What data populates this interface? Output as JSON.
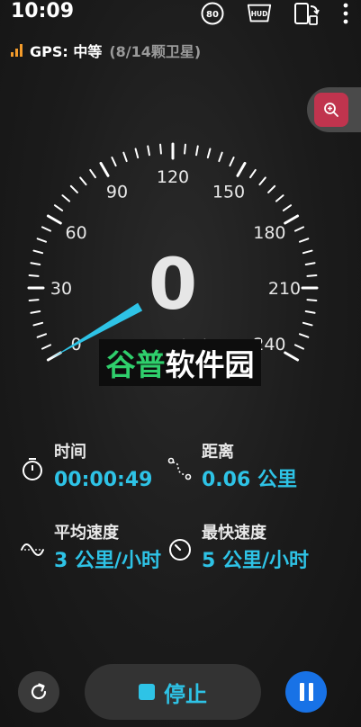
{
  "status_bar": {
    "time": "10:09",
    "speed_limit": "80",
    "hud_label": "HUD",
    "icons": [
      "speed-limit-icon",
      "hud-icon",
      "phone-rotate-icon",
      "more-vert-icon"
    ]
  },
  "gps": {
    "label": "GPS: 中等",
    "satellites": "(8/14颗卫星)",
    "signal_color": "#f39b2b"
  },
  "zoom_button": {
    "icon": "zoom-in-icon",
    "color": "#c0344e"
  },
  "gauge": {
    "labels": [
      "0",
      "30",
      "60",
      "90",
      "120",
      "150",
      "180",
      "210",
      "240"
    ],
    "speed": "0",
    "unit": "公里/小时",
    "needle_color": "#2ec3e6"
  },
  "watermark": {
    "text_green": "谷普",
    "text_white": "软件园"
  },
  "stats": {
    "time": {
      "label": "时间",
      "value": "00:00:49",
      "icon": "stopwatch-icon"
    },
    "distance": {
      "label": "距离",
      "value": "0.06 公里",
      "icon": "route-icon"
    },
    "avg_speed": {
      "label": "平均速度",
      "value": "3 公里/小时",
      "icon": "wave-icon"
    },
    "max_speed": {
      "label": "最快速度",
      "value": "5 公里/小时",
      "icon": "gauge-icon"
    }
  },
  "controls": {
    "reset_icon": "refresh-icon",
    "stop_label": "停止",
    "pause_icon": "pause-icon",
    "accent": "#2ec3e6",
    "pause_color": "#1872e6"
  }
}
